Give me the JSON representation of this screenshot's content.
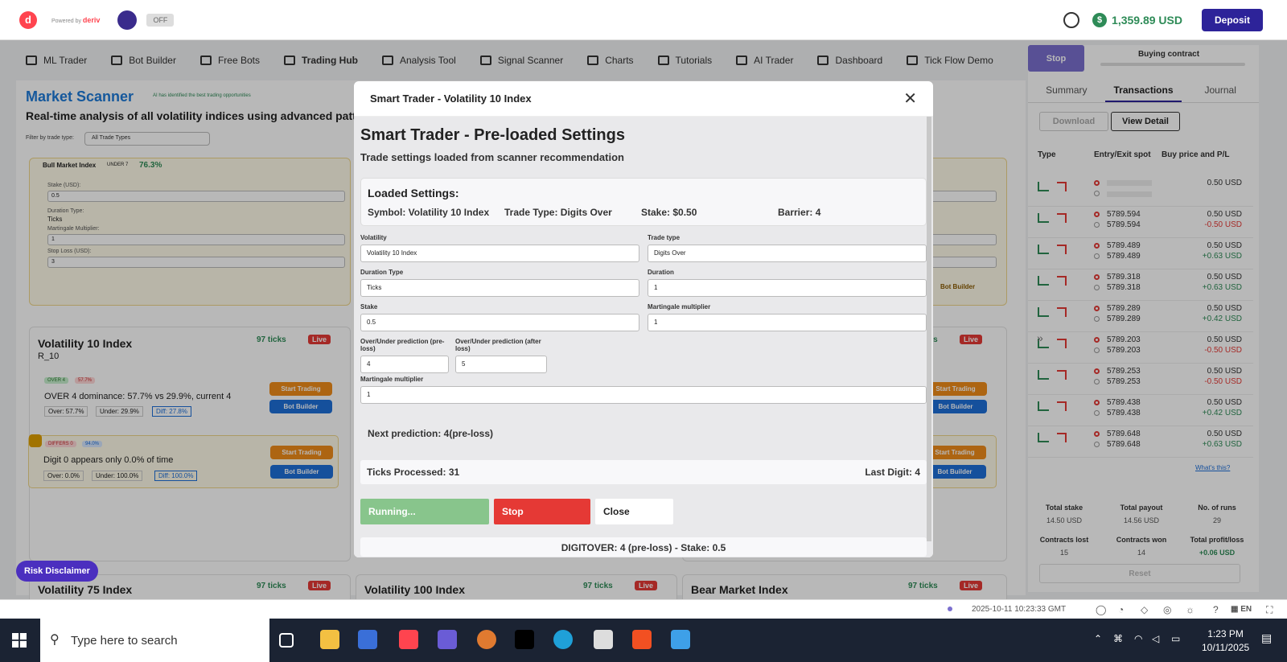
{
  "topbar": {
    "logo_letter": "d",
    "powered_by": "Powered by",
    "brand": "deriv",
    "toggle": "OFF",
    "balance": "1,359.89 USD",
    "deposit": "Deposit"
  },
  "nav": {
    "items": [
      "ML Trader",
      "Bot Builder",
      "Free Bots",
      "Trading Hub",
      "Analysis Tool",
      "Signal Scanner",
      "Charts",
      "Tutorials",
      "AI Trader",
      "Dashboard",
      "Tick Flow Demo"
    ]
  },
  "scanner": {
    "title": "Market Scanner",
    "ai_note": "AI has identified the best trading opportunities",
    "subtitle": "Real-time analysis of all volatility indices using advanced pattern",
    "filter_label": "Filter by trade type:",
    "filter_value": "All Trade Types",
    "bull": {
      "name": "Bull Market Index",
      "badge": "UNDER 7",
      "pct": "76.3%",
      "stake_lbl": "Stake (USD):",
      "stake": "0.5",
      "dur_lbl": "Duration Type:",
      "dur": "Ticks",
      "mart_lbl": "Martingale Multiplier:",
      "mart": "1",
      "sl_lbl": "Stop Loss (USD):",
      "sl": "3"
    },
    "v10": {
      "name": "Volatility 10 Index",
      "code": "R_10",
      "ticks": "97 ticks",
      "live": "Live",
      "sig1_badge": "OVER 4",
      "sig1_pct": "57.7%",
      "sig1_text": "OVER 4 dominance: 57.7% vs 29.9%, current 4",
      "sig1_over": "Over: 57.7%",
      "sig1_under": "Under: 29.9%",
      "sig1_diff": "Diff: 27.8%",
      "sig2_badge": "DIFFERS 0",
      "sig2_pct": "94.0%",
      "sig2_text": "Digit 0 appears only 0.0% of time",
      "sig2_over": "Over: 0.0%",
      "sig2_under": "Under: 100.0%",
      "sig2_diff": "Diff: 100.0%",
      "start_btn": "Start Trading",
      "bot_btn": "Bot Builder"
    },
    "v75": {
      "name": "Volatility 75 Index",
      "ticks": "97 ticks",
      "live": "Live"
    },
    "v100": {
      "name": "Volatility 100 Index",
      "ticks": "97 ticks",
      "live": "Live"
    },
    "bear": {
      "name": "Bear Market Index",
      "ticks": "97 ticks",
      "live": "Live"
    },
    "right_ticks": "97 ticks",
    "right_live": "Live",
    "right_bot": "Bot Builder"
  },
  "risk": "Risk Disclaimer",
  "modal": {
    "header": "Smart Trader - Volatility 10 Index",
    "title": "Smart Trader - Pre-loaded Settings",
    "subtitle": "Trade settings loaded from scanner recommendation",
    "loaded_title": "Loaded Settings:",
    "loaded_symbol": "Symbol: Volatility 10 Index",
    "loaded_type": "Trade Type: Digits Over",
    "loaded_stake": "Stake: $0.50",
    "loaded_barrier": "Barrier: 4",
    "vol_lbl": "Volatility",
    "vol": "Volatility 10 Index",
    "tt_lbl": "Trade type",
    "tt": "Digits Over",
    "dt_lbl": "Duration Type",
    "dt": "Ticks",
    "dur_lbl": "Duration",
    "dur": "1",
    "stake_lbl": "Stake",
    "stake": "0.5",
    "mm_lbl": "Martingale multiplier",
    "mm": "1",
    "pre_lbl": "Over/Under prediction (pre-loss)",
    "pre": "4",
    "post_lbl": "Over/Under prediction (after loss)",
    "post": "5",
    "mm2_lbl": "Martingale multiplier",
    "mm2": "1",
    "next_pred": "Next prediction: 4(pre-loss)",
    "ticks_processed": "Ticks Processed: 31",
    "last_digit": "Last Digit: 4",
    "running": "Running...",
    "stop": "Stop",
    "close": "Close",
    "status": "DIGITOVER: 4 (pre-loss) - Stake: 0.5"
  },
  "right": {
    "stop": "Stop",
    "buying": "Buying contract",
    "tabs": [
      "Summary",
      "Transactions",
      "Journal"
    ],
    "download": "Download",
    "view_detail": "View Detail",
    "col_type": "Type",
    "col_spot": "Entry/Exit spot",
    "col_buy": "Buy price and P/L",
    "rows": [
      {
        "entry": "",
        "exit": "",
        "buy": "0.50 USD",
        "pl": ""
      },
      {
        "entry": "5789.594",
        "exit": "5789.594",
        "buy": "0.50 USD",
        "pl": "-0.50 USD"
      },
      {
        "entry": "5789.489",
        "exit": "5789.489",
        "buy": "0.50 USD",
        "pl": "+0.63 USD"
      },
      {
        "entry": "5789.318",
        "exit": "5789.318",
        "buy": "0.50 USD",
        "pl": "+0.63 USD"
      },
      {
        "entry": "5789.289",
        "exit": "5789.289",
        "buy": "0.50 USD",
        "pl": "+0.42 USD"
      },
      {
        "entry": "5789.203",
        "exit": "5789.203",
        "buy": "0.50 USD",
        "pl": "-0.50 USD"
      },
      {
        "entry": "5789.253",
        "exit": "5789.253",
        "buy": "0.50 USD",
        "pl": "-0.50 USD"
      },
      {
        "entry": "5789.438",
        "exit": "5789.438",
        "buy": "0.50 USD",
        "pl": "+0.42 USD"
      },
      {
        "entry": "5789.648",
        "exit": "5789.648",
        "buy": "0.50 USD",
        "pl": "+0.63 USD"
      }
    ],
    "whats_this": "What's this?",
    "total_stake_lbl": "Total stake",
    "total_stake": "14.50 USD",
    "total_payout_lbl": "Total payout",
    "total_payout": "14.56 USD",
    "runs_lbl": "No. of runs",
    "runs": "29",
    "lost_lbl": "Contracts lost",
    "lost": "15",
    "won_lbl": "Contracts won",
    "won": "14",
    "profit_lbl": "Total profit/loss",
    "profit": "+0.06 USD",
    "reset": "Reset"
  },
  "footer": {
    "time": "2025-10-11 10:23:33 GMT",
    "lang": "EN"
  },
  "taskbar": {
    "search": "Type here to search",
    "clock_time": "1:23 PM",
    "clock_date": "10/11/2025"
  }
}
